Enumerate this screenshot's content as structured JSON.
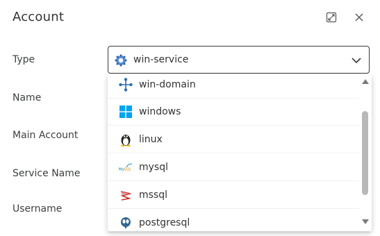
{
  "dialog": {
    "title": "Account"
  },
  "header": {
    "expand_icon": "expand-icon",
    "close_icon": "close-icon"
  },
  "fields": {
    "type_label": "Type",
    "name_label": "Name",
    "main_account_label": "Main Account",
    "service_name_label": "Service Name",
    "username_label": "Username"
  },
  "type_select": {
    "value": "win-service",
    "icon": "gear-icon"
  },
  "dropdown": {
    "options": [
      {
        "label": "win-domain",
        "icon": "network-icon"
      },
      {
        "label": "windows",
        "icon": "windows-icon"
      },
      {
        "label": "linux",
        "icon": "linux-penguin-icon"
      },
      {
        "label": "mysql",
        "icon": "mysql-icon"
      },
      {
        "label": "mssql",
        "icon": "mssql-icon"
      },
      {
        "label": "postgresql",
        "icon": "postgresql-icon"
      }
    ]
  },
  "colors": {
    "accent": "#1a73c8",
    "windows_blue": "#00a4ef",
    "mssql_red": "#cc2927",
    "postgres_blue": "#336791"
  }
}
